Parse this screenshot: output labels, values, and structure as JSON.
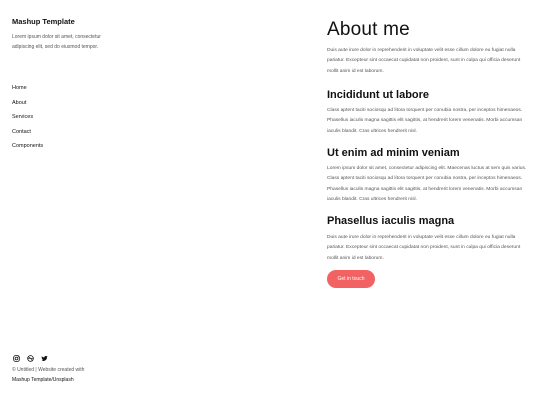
{
  "sidebar": {
    "title": "Mashup Template",
    "description": "Lorem ipsum dolor sit amet, consectetur adipiscing elit, sed do eiusmod tempor.",
    "nav": [
      "Home",
      "About",
      "Services",
      "Contact",
      "Components"
    ],
    "social_icons": [
      "instagram-icon",
      "dribbble-icon",
      "twitter-icon"
    ],
    "credit_line1": "© Untitled | Website created with",
    "credit_line2": "Mashup Template/Unsplash"
  },
  "main": {
    "heading": "About me",
    "intro": "Duis aute irure dolor in reprehenderit in voluptate velit esse cillum dolore eu fugiat nulla pariatur. Excepteur sint occaecat cupidatat non proident, sunt in culpa qui officia deserunt mollit anim id est laborum.",
    "section1_title": "Incididunt ut labore",
    "section1_text": "Class aptent taciti sociosqu ad litora torquent per conubia nostra, per inceptos himenaeos. Phasellus iaculis magna sagittis elit sagittis, at hendrerit lorem venenatis. Morbi accumsan iaculis blandit. Cras ultrices hendrerit nisl.",
    "section2_title": "Ut enim ad minim veniam",
    "section2_text": "Lorem ipsum dolor sit amet, consectetur adipiscing elit. Maecenas luctus at sem quis varius. Class aptent taciti sociosqu ad litora torquent per conubia nostra, per inceptos himenaeos. Phasellus iaculis magna sagittis elit sagittis, at hendrerit lorem venenatis. Morbi accumsan iaculis blandit. Cras ultrices hendrerit nisl.",
    "section3_title": "Phasellus iaculis magna",
    "section3_text": "Duis aute irure dolor in reprehenderit in voluptate velit esse cillum dolore eu fugiat nulla pariatur. Excepteur sint occaecat cupidatat non proident, sunt in culpa qui officia deserunt mollit anim id est laborum.",
    "cta_label": "Get in touch"
  },
  "colors": {
    "accent": "#f26262"
  }
}
